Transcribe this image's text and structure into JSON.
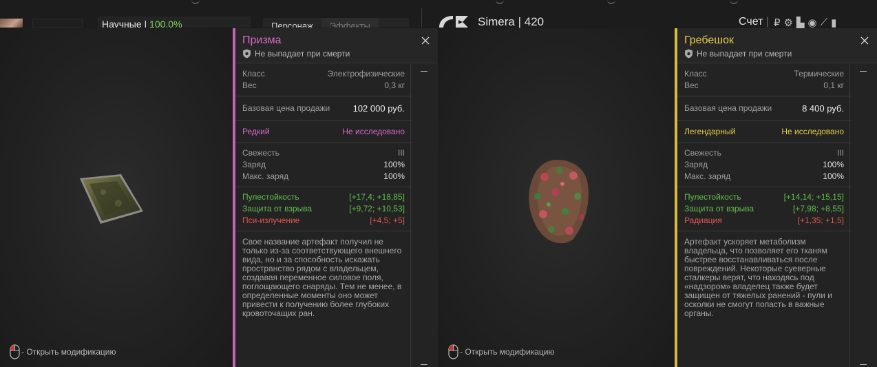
{
  "hud": {
    "stat_label": "Научные",
    "stat_sep": "|",
    "stat_value": "100.0%",
    "tabs": [
      "Персонаж",
      "Эффекты"
    ],
    "player_name": "Simera",
    "player_sep": "|",
    "player_level": "420",
    "score_label": "Счет"
  },
  "left": {
    "hint": "- Открыть модификацию",
    "card": {
      "title": "Призма",
      "subtitle": "Не выпадает при смерти",
      "class_label": "Класс",
      "class_value": "Электрофизические",
      "weight_label": "Вес",
      "weight_value": "0,3 кг",
      "price_label": "Базовая цена продажи",
      "price_value": "102 000 руб.",
      "rarity": "Редкий",
      "research": "Не исследовано",
      "freshness_label": "Свежесть",
      "freshness_value": "III",
      "charge_label": "Заряд",
      "charge_value": "100%",
      "maxcharge_label": "Макс. заряд",
      "maxcharge_value": "100%",
      "stats": [
        {
          "label": "Пулестойкость",
          "value": "[+17,4; +18,85]"
        },
        {
          "label": "Защита от взрыва",
          "value": "[+9,72; +10,53]"
        },
        {
          "label": "Пси-излучение",
          "value": "[+4,5; +5]"
        }
      ],
      "description": "Свое название артефакт получил не только из-за соответствующего внешнего вида, но и за способность искажать пространство рядом с владельцем, создавая переменное силовое поля, поглощающего снаряды. Тем не менее, в определенные моменты оно может привести к получению более глубоких кровоточащих ран."
    }
  },
  "right": {
    "hint": "- Открыть модификацию",
    "card": {
      "title": "Гребешок",
      "subtitle": "Не выпадает при смерти",
      "class_label": "Класс",
      "class_value": "Термические",
      "weight_label": "Вес",
      "weight_value": "0,1 кг",
      "price_label": "Базовая цена продажи",
      "price_value": "8 400 руб.",
      "rarity": "Легендарный",
      "research": "Не исследовано",
      "freshness_label": "Свежесть",
      "freshness_value": "III",
      "charge_label": "Заряд",
      "charge_value": "100%",
      "maxcharge_label": "Макс. заряд",
      "maxcharge_value": "100%",
      "stats": [
        {
          "label": "Пулестойкость",
          "value": "[+14,14; +15,15]"
        },
        {
          "label": "Защита от взрыва",
          "value": "[+7,98; +8,55]"
        },
        {
          "label": "Радиация",
          "value": "[+1,35; +1,5]"
        }
      ],
      "description": "Артефакт ускоряет метаболизм владельца, что позволяет его тканям быстрее восстанавливаться после повреждений. Некоторые суеверные сталкеры верят, что находясь под «надзором» владелец также будет защищен от тяжелых ранений - пули и осколки не смогут попасть в важные органы."
    }
  },
  "colors": {
    "rare": "#d969c7",
    "legendary": "#e6cc4a",
    "positive": "#5fc04a",
    "negative": "#e0574f"
  }
}
